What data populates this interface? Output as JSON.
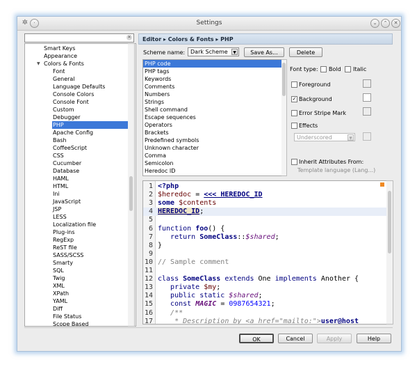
{
  "window": {
    "title": "Settings"
  },
  "search": {
    "placeholder": ""
  },
  "tree": {
    "items": [
      {
        "label": "Smart Keys",
        "level": 1
      },
      {
        "label": "Appearance",
        "level": 1
      },
      {
        "label": "Colors & Fonts",
        "level": 1,
        "expanded": true
      },
      {
        "label": "Font",
        "level": 2
      },
      {
        "label": "General",
        "level": 2
      },
      {
        "label": "Language Defaults",
        "level": 2
      },
      {
        "label": "Console Colors",
        "level": 2
      },
      {
        "label": "Console Font",
        "level": 2
      },
      {
        "label": "Custom",
        "level": 2
      },
      {
        "label": "Debugger",
        "level": 2
      },
      {
        "label": "PHP",
        "level": 2,
        "selected": true
      },
      {
        "label": "Apache Config",
        "level": 2
      },
      {
        "label": "Bash",
        "level": 2
      },
      {
        "label": "CoffeeScript",
        "level": 2
      },
      {
        "label": "CSS",
        "level": 2
      },
      {
        "label": "Cucumber",
        "level": 2
      },
      {
        "label": "Database",
        "level": 2
      },
      {
        "label": "HAML",
        "level": 2
      },
      {
        "label": "HTML",
        "level": 2
      },
      {
        "label": "Ini",
        "level": 2
      },
      {
        "label": "JavaScript",
        "level": 2
      },
      {
        "label": "JSP",
        "level": 2
      },
      {
        "label": "LESS",
        "level": 2
      },
      {
        "label": "Localization file",
        "level": 2
      },
      {
        "label": "Plug-ins",
        "level": 2
      },
      {
        "label": "RegExp",
        "level": 2
      },
      {
        "label": "ReST file",
        "level": 2
      },
      {
        "label": "SASS/SCSS",
        "level": 2
      },
      {
        "label": "Smarty",
        "level": 2
      },
      {
        "label": "SQL",
        "level": 2
      },
      {
        "label": "Twig",
        "level": 2
      },
      {
        "label": "XML",
        "level": 2
      },
      {
        "label": "XPath",
        "level": 2
      },
      {
        "label": "YAML",
        "level": 2
      },
      {
        "label": "Diff",
        "level": 2
      },
      {
        "label": "File Status",
        "level": 2
      },
      {
        "label": "Scope Based",
        "level": 2
      }
    ]
  },
  "breadcrumb": "Editor ▸ Colors & Fonts ▸ PHP",
  "scheme": {
    "label": "Scheme name:",
    "value": "Dark Scheme",
    "save_as": "Save As...",
    "delete": "Delete"
  },
  "elements": [
    "PHP code",
    "PHP tags",
    "Keywords",
    "Comments",
    "Numbers",
    "Strings",
    "Shell command",
    "Escape sequences",
    "Operators",
    "Brackets",
    "Predefined symbols",
    "Unknown character",
    "Comma",
    "Semicolon",
    "Heredoc ID"
  ],
  "attrs": {
    "font_type_label": "Font type:",
    "bold": "Bold",
    "italic": "Italic",
    "foreground": "Foreground",
    "background": "Background",
    "error_stripe": "Error Stripe Mark",
    "effects": "Effects",
    "effect_type": "Underscored",
    "inherit": "Inherit Attributes From:",
    "inherit_from": "Template language (Lang...)",
    "background_checked": true
  },
  "editor": {
    "line_numbers": [
      "1",
      "2",
      "3",
      "4",
      "5",
      "6",
      "7",
      "8",
      "9",
      "10",
      "11",
      "12",
      "13",
      "14",
      "15",
      "16",
      "17"
    ],
    "code": {
      "l1": "<?php",
      "l2a": "$heredoc",
      "l2b": " = ",
      "l2c": "<<< HEREDOC_ID",
      "l3a": "some ",
      "l3b": "$contents",
      "l4a": "HEREDOC_ID",
      "l4b": ";",
      "l6a": "function ",
      "l6b": "foo",
      "l6c": "() {",
      "l7a": "   return ",
      "l7b": "SomeClass",
      "l7c": "::",
      "l7d": "$shared",
      "l7e": ";",
      "l8": "}",
      "l10": "// Sample comment",
      "l12a": "class ",
      "l12b": "SomeClass ",
      "l12c": "extends ",
      "l12d": "One ",
      "l12e": "implements ",
      "l12f": "Another {",
      "l13a": "   private ",
      "l13b": "$my",
      "l13c": ";",
      "l14a": "   public static ",
      "l14b": "$shared",
      "l14c": ";",
      "l15a": "   const ",
      "l15b": "MAGIC",
      "l15c": " = ",
      "l15d": "0987654321",
      "l15e": ";",
      "l16": "   /**",
      "l17a": "    * Description by <a href=\"mailto:\">",
      "l17b": "user@host"
    }
  },
  "buttons": {
    "ok": "OK",
    "cancel": "Cancel",
    "apply": "Apply",
    "help": "Help"
  }
}
